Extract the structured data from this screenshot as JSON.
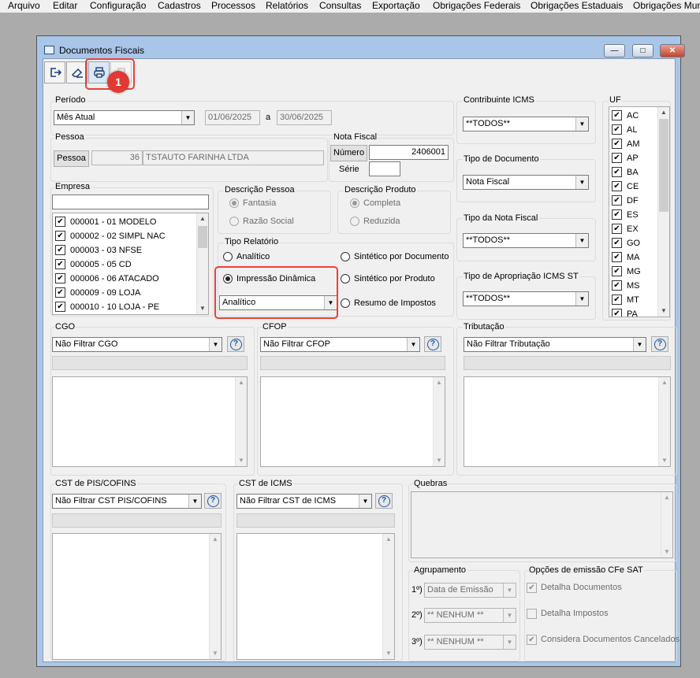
{
  "menu": [
    "Arquivo",
    "Editar",
    "Configuração",
    "Cadastros",
    "Processos",
    "Relatórios",
    "Consultas",
    "Exportação",
    "Obrigações Federais",
    "Obrigações Estaduais",
    "Obrigações Mun"
  ],
  "window": {
    "title": "Documentos Fiscais",
    "minimize": "—",
    "maximize": "□",
    "close": "✕"
  },
  "toolbar": {
    "badge": "1"
  },
  "periodo": {
    "label": "Período",
    "selected": "Mês Atual",
    "date_from": "01/06/2025",
    "sep": "a",
    "date_to": "30/06/2025"
  },
  "pessoa": {
    "label": "Pessoa",
    "button": "Pessoa",
    "code": "36",
    "name": "TSTAUTO FARINHA LTDA"
  },
  "nota_fiscal": {
    "label": "Nota Fiscal",
    "numero_label": "Número",
    "numero_value": "2406001",
    "serie_label": "Série",
    "serie_value": ""
  },
  "empresa": {
    "label": "Empresa",
    "filter_value": "",
    "items": [
      {
        "label": "000001 - 01 MODELO",
        "checked": true
      },
      {
        "label": "000002 - 02 SIMPL NAC",
        "checked": true
      },
      {
        "label": "000003 - 03 NFSE",
        "checked": true
      },
      {
        "label": "000005 - 05 CD",
        "checked": true
      },
      {
        "label": "000006 - 06 ATACADO",
        "checked": true
      },
      {
        "label": "000009 - 09 LOJA",
        "checked": true
      },
      {
        "label": "000010 - 10 LOJA - PE",
        "checked": true
      }
    ]
  },
  "descricao_pessoa": {
    "label": "Descrição Pessoa",
    "options": [
      "Fantasia",
      "Razão Social"
    ],
    "selected": 0
  },
  "descricao_produto": {
    "label": "Descrição Produto",
    "options": [
      "Completa",
      "Reduzida"
    ],
    "selected": 0
  },
  "tipo_relatorio": {
    "label": "Tipo Relatório",
    "options": [
      "Analítico",
      "Impressão Dinâmica",
      "Sintético por Documento",
      "Sintético por Produto",
      "Resumo de Impostos"
    ],
    "selected": "Impressão Dinâmica",
    "dynamic_combo": "Analítico"
  },
  "contribuinte_icms": {
    "label": "Contribuinte ICMS",
    "selected": "**TODOS**"
  },
  "tipo_documento": {
    "label": "Tipo de Documento",
    "selected": "Nota Fiscal"
  },
  "tipo_nota_fiscal": {
    "label": "Tipo da Nota Fiscal",
    "selected": "**TODOS**"
  },
  "tipo_apropriacao": {
    "label": "Tipo de Apropriação ICMS ST",
    "selected": "**TODOS**"
  },
  "uf": {
    "label": "UF",
    "items": [
      {
        "label": "AC",
        "checked": true
      },
      {
        "label": "AL",
        "checked": true
      },
      {
        "label": "AM",
        "checked": true
      },
      {
        "label": "AP",
        "checked": true
      },
      {
        "label": "BA",
        "checked": true
      },
      {
        "label": "CE",
        "checked": true
      },
      {
        "label": "DF",
        "checked": true
      },
      {
        "label": "ES",
        "checked": true
      },
      {
        "label": "EX",
        "checked": true
      },
      {
        "label": "GO",
        "checked": true
      },
      {
        "label": "MA",
        "checked": true
      },
      {
        "label": "MG",
        "checked": true
      },
      {
        "label": "MS",
        "checked": true
      },
      {
        "label": "MT",
        "checked": true
      },
      {
        "label": "PA",
        "checked": true
      }
    ]
  },
  "cgo": {
    "label": "CGO",
    "selected": "Não Filtrar CGO"
  },
  "cfop": {
    "label": "CFOP",
    "selected": "Não Filtrar CFOP"
  },
  "tributacao": {
    "label": "Tributação",
    "selected": "Não Filtrar Tributação"
  },
  "cst_pis": {
    "label": "CST de PIS/COFINS",
    "selected": "Não Filtrar CST PIS/COFINS"
  },
  "cst_icms": {
    "label": "CST de ICMS",
    "selected": "Não Filtrar CST de ICMS"
  },
  "quebras": {
    "label": "Quebras"
  },
  "agrupamento": {
    "label": "Agrupamento",
    "rows": [
      {
        "ordinal": "1º)",
        "value": "Data de Emissão"
      },
      {
        "ordinal": "2º)",
        "value": "** NENHUM **"
      },
      {
        "ordinal": "3º)",
        "value": "** NENHUM **"
      }
    ]
  },
  "opcoes_cfe": {
    "label": "Opções de emissão CFe SAT",
    "items": [
      {
        "label": "Detalha Documentos",
        "checked": true
      },
      {
        "label": "Detalha Impostos",
        "checked": false
      },
      {
        "label": "Considera Documentos Cancelados",
        "checked": true
      }
    ]
  },
  "colors": {
    "highlight": "#e8413b",
    "window_frame": "#a9c6e8",
    "help_icon": "#1a56a8"
  },
  "help_glyph": "?"
}
